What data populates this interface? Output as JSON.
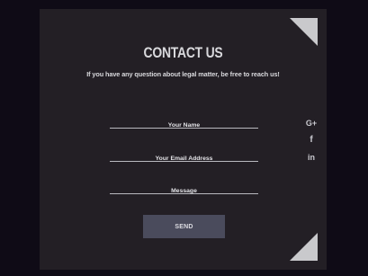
{
  "contact": {
    "title": "CONTACT US",
    "subtitle": "If you have any question about legal matter, be free to reach us!",
    "fields": {
      "name_placeholder": "Your Name",
      "email_placeholder": "Your Email Address",
      "message_placeholder": "Message"
    },
    "send_label": "SEND"
  },
  "social": {
    "google_plus": "G+",
    "facebook": "f",
    "linkedin": "in"
  },
  "colors": {
    "page_background": "#0f0b16",
    "card_background": "#231f25",
    "corner_accent": "#c9c9cc",
    "button_background": "#4a4b5c",
    "text": "#d8d8dc"
  }
}
